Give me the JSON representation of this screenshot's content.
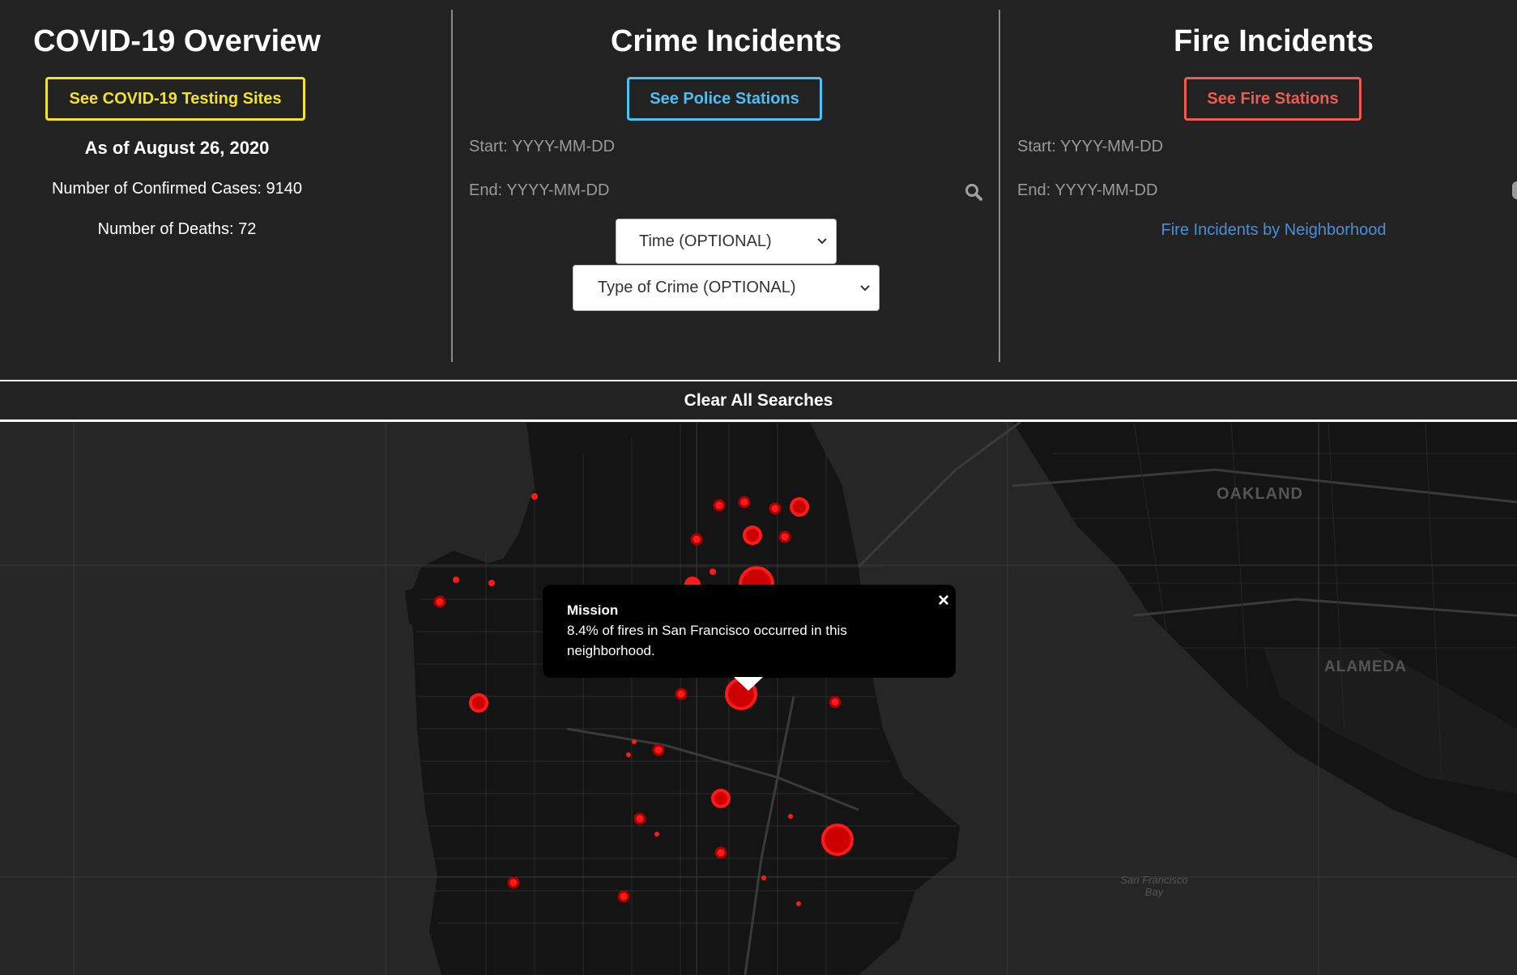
{
  "covid": {
    "title": "COVID-19 Overview",
    "button_label": "See COVID-19 Testing Sites",
    "as_of": "As of August 26, 2020",
    "confirmed": "Number of Confirmed Cases: 9140",
    "deaths": "Number of Deaths: 72"
  },
  "crime": {
    "title": "Crime Incidents",
    "button_label": "See Police Stations",
    "start_placeholder": "Start: YYYY-MM-DD",
    "end_placeholder": "End: YYYY-MM-DD",
    "time_select": "Time (OPTIONAL)",
    "type_select": "Type of Crime (OPTIONAL)"
  },
  "fire": {
    "title": "Fire Incidents",
    "button_label": "See Fire Stations",
    "start_placeholder": "Start: YYYY-MM-DD",
    "end_placeholder": "End: YYYY-MM-DD",
    "link": "Fire Incidents by Neighborhood"
  },
  "clear_label": "Clear All Searches",
  "map": {
    "labels": {
      "oakland": "OAKLAND",
      "alameda": "ALAMEDA",
      "bay_line1": "San Francisco",
      "bay_line2": "Bay"
    },
    "popup": {
      "title": "Mission",
      "body": "8.4% of fires in San Francisco occurred in this neighborhood.",
      "close": "×"
    }
  },
  "colors": {
    "background": "#222222",
    "yellow": "#f2e229",
    "blue": "#4cc0f2",
    "red": "#ee5b50",
    "link": "#4a8fd6",
    "marker": "#ff1a1a"
  }
}
